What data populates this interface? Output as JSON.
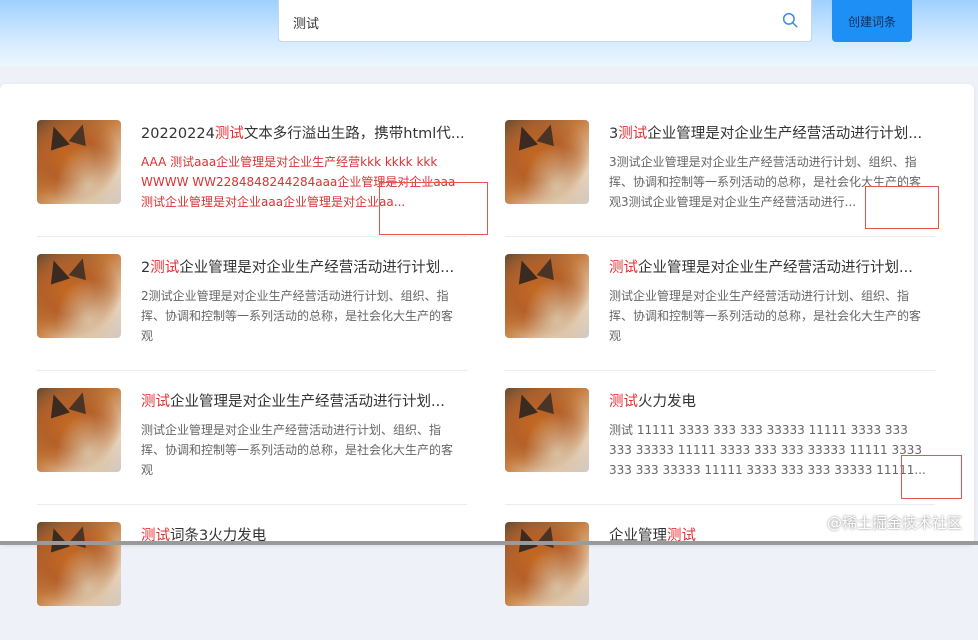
{
  "search": {
    "value": "测试",
    "placeholder": ""
  },
  "create_button": "创建词条",
  "highlight_color": "#e03131",
  "cards": [
    {
      "title_pre": "20220224",
      "title_hl": "测试",
      "title_post": "文本多行溢出生路，携带html代...",
      "desc": "AAA 测试aaa企业管理是对企业生产经营kkk kkkk kkk WWWW WW2284848244284aaa企业管理是对企业aaa测试企业管理是对企业aaa企业管理是对企业aa..."
    },
    {
      "title_pre": "3",
      "title_hl": "测试",
      "title_post": "企业管理是对企业生产经营活动进行计划...",
      "desc": "3测试企业管理是对企业生产经营活动进行计划、组织、指挥、协调和控制等一系列活动的总称，是社会化大生产的客观3测试企业管理是对企业生产经营活动进行..."
    },
    {
      "title_pre": "2",
      "title_hl": "测试",
      "title_post": "企业管理是对企业生产经营活动进行计划...",
      "desc": "2测试企业管理是对企业生产经营活动进行计划、组织、指挥、协调和控制等一系列活动的总称，是社会化大生产的客观"
    },
    {
      "title_pre": "",
      "title_hl": "测试",
      "title_post": "企业管理是对企业生产经营活动进行计划...",
      "desc": "测试企业管理是对企业生产经营活动进行计划、组织、指挥、协调和控制等一系列活动的总称，是社会化大生产的客观"
    },
    {
      "title_pre": "",
      "title_hl": "测试",
      "title_post": "企业管理是对企业生产经营活动进行计划...",
      "desc": "测试企业管理是对企业生产经营活动进行计划、组织、指挥、协调和控制等一系列活动的总称，是社会化大生产的客观"
    },
    {
      "title_pre": "",
      "title_hl": "测试",
      "title_post": "火力发电",
      "desc": "测试 11111 3333 333 333 33333 11111 3333 333 333 33333 11111 3333 333 333 33333 11111 3333 333 333 33333 11111 3333 333 333 33333 11111..."
    },
    {
      "title_pre": "",
      "title_hl": "测试",
      "title_post": "词条3火力发电",
      "desc": ""
    },
    {
      "title_pre": "企业管理",
      "title_hl": "测试",
      "title_post": "",
      "desc": ""
    }
  ],
  "watermark": "@稀土掘金技术社区"
}
